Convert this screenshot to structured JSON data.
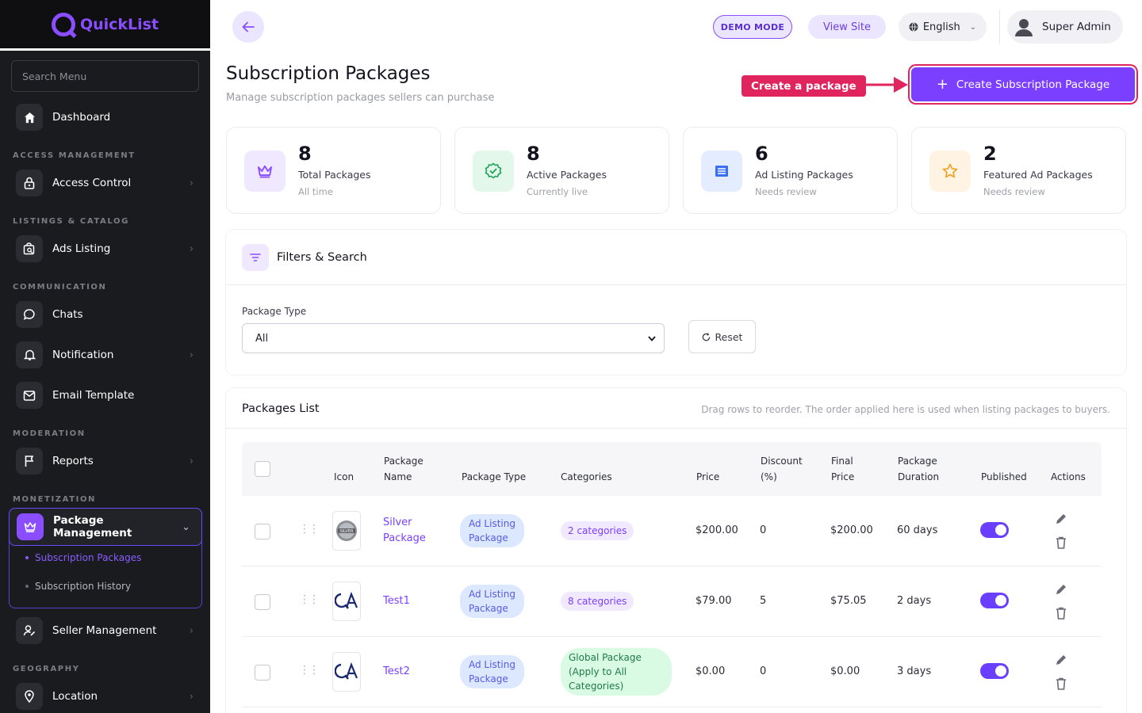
{
  "app": {
    "name": "QuickList"
  },
  "sidebar": {
    "search_placeholder": "Search Menu",
    "dashboard": "Dashboard",
    "sections": {
      "access": "ACCESS MANAGEMENT",
      "listings": "LISTINGS & CATALOG",
      "communication": "COMMUNICATION",
      "moderation": "MODERATION",
      "monetization": "MONETIZATION",
      "geography": "GEOGRAPHY"
    },
    "items": {
      "access_control": "Access Control",
      "ads_listing": "Ads Listing",
      "chats": "Chats",
      "notification": "Notification",
      "email_template": "Email Template",
      "reports": "Reports",
      "package_management": "Package Management",
      "subscription_packages": "Subscription Packages",
      "subscription_history": "Subscription History",
      "seller_management": "Seller Management",
      "location": "Location"
    }
  },
  "topbar": {
    "demo_mode": "DEMO MODE",
    "view_site": "View Site",
    "language": "English",
    "user": "Super Admin"
  },
  "page": {
    "title": "Subscription Packages",
    "subtitle": "Manage subscription packages sellers can purchase",
    "create_button": "Create Subscription Package",
    "callout": "Create a package"
  },
  "stats": [
    {
      "value": "8",
      "label": "Total Packages",
      "sub": "All time",
      "icon": "crown-icon"
    },
    {
      "value": "8",
      "label": "Active Packages",
      "sub": "Currently live",
      "icon": "badge-check-icon"
    },
    {
      "value": "6",
      "label": "Ad Listing Packages",
      "sub": "Needs review",
      "icon": "list-icon"
    },
    {
      "value": "2",
      "label": "Featured Ad Packages",
      "sub": "Needs review",
      "icon": "star-icon"
    }
  ],
  "filters": {
    "title": "Filters & Search",
    "package_type_label": "Package Type",
    "package_type_value": "All",
    "reset": "Reset"
  },
  "list": {
    "title": "Packages List",
    "hint": "Drag rows to reorder. The order applied here is used when listing packages to buyers.",
    "columns": {
      "icon": "Icon",
      "name_1": "Package",
      "name_2": "Name",
      "type": "Package Type",
      "categories": "Categories",
      "price": "Price",
      "discount_1": "Discount",
      "discount_2": "(%)",
      "final_1": "Final",
      "final_2": "Price",
      "duration_1": "Package",
      "duration_2": "Duration",
      "published": "Published",
      "actions": "Actions"
    },
    "rows": [
      {
        "name_1": "Silver",
        "name_2": "Package",
        "type_1": "Ad Listing",
        "type_2": "Package",
        "categories": "2 categories",
        "price": "$200.00",
        "discount": "0",
        "final": "$200.00",
        "duration": "60 days",
        "published": true
      },
      {
        "name_1": "Test1",
        "name_2": "",
        "type_1": "Ad Listing",
        "type_2": "Package",
        "categories": "8 categories",
        "price": "$79.00",
        "discount": "5",
        "final": "$75.05",
        "duration": "2 days",
        "published": true
      },
      {
        "name_1": "Test2",
        "name_2": "",
        "type_1": "Ad Listing",
        "type_2": "Package",
        "categories_1": "Global Package",
        "categories_2": "(Apply to All",
        "categories_3": "Categories)",
        "price": "$0.00",
        "discount": "0",
        "final": "$0.00",
        "duration": "3 days",
        "published": true
      }
    ]
  },
  "colors": {
    "accent": "#7a3fff",
    "callout": "#e0245e",
    "sidebar_bg": "#1a1b1f"
  }
}
